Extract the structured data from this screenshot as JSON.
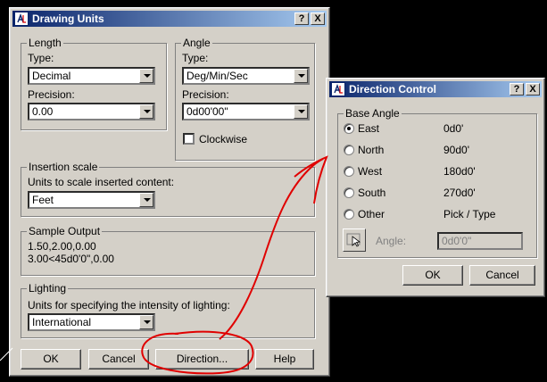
{
  "drawing_units": {
    "title": "Drawing Units",
    "help_btn": "?",
    "close_btn": "X",
    "length": {
      "group_label": "Length",
      "type_label": "Type:",
      "type_value": "Decimal",
      "precision_label": "Precision:",
      "precision_value": "0.00"
    },
    "angle": {
      "group_label": "Angle",
      "type_label": "Type:",
      "type_value": "Deg/Min/Sec",
      "precision_label": "Precision:",
      "precision_value": "0d00'00\"",
      "clockwise_label": "Clockwise",
      "clockwise_checked": false
    },
    "insertion": {
      "group_label": "Insertion scale",
      "desc": "Units to scale inserted content:",
      "value": "Feet"
    },
    "sample": {
      "group_label": "Sample Output",
      "line1": "1.50,2.00,0.00",
      "line2": "3.00<45d0'0\",0.00"
    },
    "lighting": {
      "group_label": "Lighting",
      "desc": "Units for specifying the intensity of lighting:",
      "value": "International"
    },
    "buttons": {
      "ok": "OK",
      "cancel": "Cancel",
      "direction": "Direction...",
      "help": "Help"
    }
  },
  "direction_control": {
    "title": "Direction Control",
    "help_btn": "?",
    "close_btn": "X",
    "group_label": "Base Angle",
    "options": [
      {
        "label": "East",
        "value": "0d0'",
        "selected": true
      },
      {
        "label": "North",
        "value": "90d0'",
        "selected": false
      },
      {
        "label": "West",
        "value": "180d0'",
        "selected": false
      },
      {
        "label": "South",
        "value": "270d0'",
        "selected": false
      },
      {
        "label": "Other",
        "value": "Pick / Type",
        "selected": false
      }
    ],
    "angle_label": "Angle:",
    "angle_value": "0d0'0\"",
    "buttons": {
      "ok": "OK",
      "cancel": "Cancel"
    }
  },
  "colors": {
    "dialog_bg": "#d4d0c8",
    "title_start": "#0a246a",
    "title_end": "#a6caf0",
    "annotation": "#e00000",
    "desktop": "#000000"
  }
}
